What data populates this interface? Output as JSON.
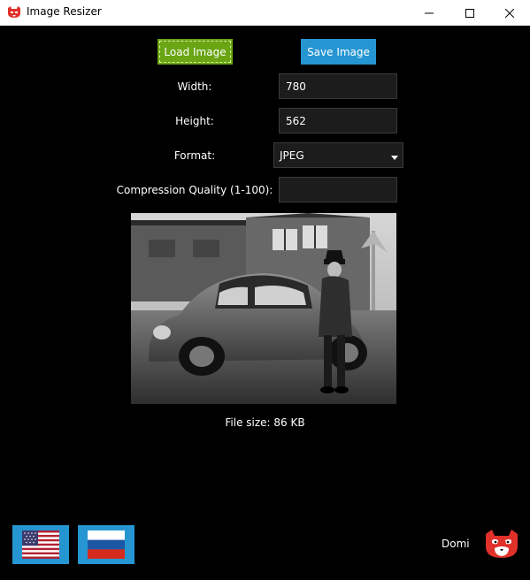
{
  "window": {
    "title": "Image Resizer",
    "icon": "red-panda-icon",
    "controls": [
      "minimize-icon",
      "maximize-icon",
      "close-icon"
    ]
  },
  "toolbar": {
    "load_label": "Load Image",
    "save_label": "Save Image",
    "load_color": "#6aa514",
    "save_color": "#2596d1"
  },
  "form": {
    "width_label": "Width:",
    "width_value": "780",
    "height_label": "Height:",
    "height_value": "562",
    "format_label": "Format:",
    "format_value": "JPEG",
    "quality_label": "Compression Quality (1-100):",
    "quality_value": ""
  },
  "preview": {
    "image": "black-and-white photo of a man standing beside a vintage car",
    "file_size": "File size: 86 KB"
  },
  "footer": {
    "languages": [
      "us-flag-icon",
      "russia-flag-icon"
    ],
    "author": "Domi",
    "logo": "red-panda-icon"
  }
}
